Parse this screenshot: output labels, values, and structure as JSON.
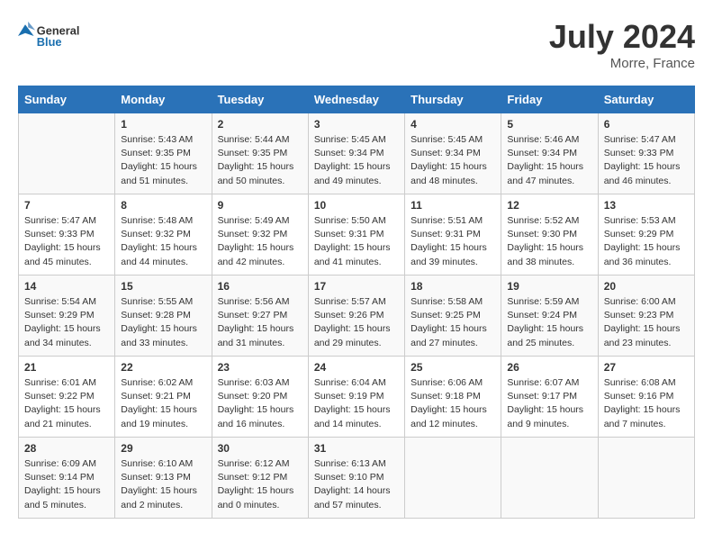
{
  "header": {
    "logo_general": "General",
    "logo_blue": "Blue",
    "month_year": "July 2024",
    "location": "Morre, France"
  },
  "days_of_week": [
    "Sunday",
    "Monday",
    "Tuesday",
    "Wednesday",
    "Thursday",
    "Friday",
    "Saturday"
  ],
  "weeks": [
    [
      {
        "day": "",
        "info": ""
      },
      {
        "day": "1",
        "info": "Sunrise: 5:43 AM\nSunset: 9:35 PM\nDaylight: 15 hours\nand 51 minutes."
      },
      {
        "day": "2",
        "info": "Sunrise: 5:44 AM\nSunset: 9:35 PM\nDaylight: 15 hours\nand 50 minutes."
      },
      {
        "day": "3",
        "info": "Sunrise: 5:45 AM\nSunset: 9:34 PM\nDaylight: 15 hours\nand 49 minutes."
      },
      {
        "day": "4",
        "info": "Sunrise: 5:45 AM\nSunset: 9:34 PM\nDaylight: 15 hours\nand 48 minutes."
      },
      {
        "day": "5",
        "info": "Sunrise: 5:46 AM\nSunset: 9:34 PM\nDaylight: 15 hours\nand 47 minutes."
      },
      {
        "day": "6",
        "info": "Sunrise: 5:47 AM\nSunset: 9:33 PM\nDaylight: 15 hours\nand 46 minutes."
      }
    ],
    [
      {
        "day": "7",
        "info": "Sunrise: 5:47 AM\nSunset: 9:33 PM\nDaylight: 15 hours\nand 45 minutes."
      },
      {
        "day": "8",
        "info": "Sunrise: 5:48 AM\nSunset: 9:32 PM\nDaylight: 15 hours\nand 44 minutes."
      },
      {
        "day": "9",
        "info": "Sunrise: 5:49 AM\nSunset: 9:32 PM\nDaylight: 15 hours\nand 42 minutes."
      },
      {
        "day": "10",
        "info": "Sunrise: 5:50 AM\nSunset: 9:31 PM\nDaylight: 15 hours\nand 41 minutes."
      },
      {
        "day": "11",
        "info": "Sunrise: 5:51 AM\nSunset: 9:31 PM\nDaylight: 15 hours\nand 39 minutes."
      },
      {
        "day": "12",
        "info": "Sunrise: 5:52 AM\nSunset: 9:30 PM\nDaylight: 15 hours\nand 38 minutes."
      },
      {
        "day": "13",
        "info": "Sunrise: 5:53 AM\nSunset: 9:29 PM\nDaylight: 15 hours\nand 36 minutes."
      }
    ],
    [
      {
        "day": "14",
        "info": "Sunrise: 5:54 AM\nSunset: 9:29 PM\nDaylight: 15 hours\nand 34 minutes."
      },
      {
        "day": "15",
        "info": "Sunrise: 5:55 AM\nSunset: 9:28 PM\nDaylight: 15 hours\nand 33 minutes."
      },
      {
        "day": "16",
        "info": "Sunrise: 5:56 AM\nSunset: 9:27 PM\nDaylight: 15 hours\nand 31 minutes."
      },
      {
        "day": "17",
        "info": "Sunrise: 5:57 AM\nSunset: 9:26 PM\nDaylight: 15 hours\nand 29 minutes."
      },
      {
        "day": "18",
        "info": "Sunrise: 5:58 AM\nSunset: 9:25 PM\nDaylight: 15 hours\nand 27 minutes."
      },
      {
        "day": "19",
        "info": "Sunrise: 5:59 AM\nSunset: 9:24 PM\nDaylight: 15 hours\nand 25 minutes."
      },
      {
        "day": "20",
        "info": "Sunrise: 6:00 AM\nSunset: 9:23 PM\nDaylight: 15 hours\nand 23 minutes."
      }
    ],
    [
      {
        "day": "21",
        "info": "Sunrise: 6:01 AM\nSunset: 9:22 PM\nDaylight: 15 hours\nand 21 minutes."
      },
      {
        "day": "22",
        "info": "Sunrise: 6:02 AM\nSunset: 9:21 PM\nDaylight: 15 hours\nand 19 minutes."
      },
      {
        "day": "23",
        "info": "Sunrise: 6:03 AM\nSunset: 9:20 PM\nDaylight: 15 hours\nand 16 minutes."
      },
      {
        "day": "24",
        "info": "Sunrise: 6:04 AM\nSunset: 9:19 PM\nDaylight: 15 hours\nand 14 minutes."
      },
      {
        "day": "25",
        "info": "Sunrise: 6:06 AM\nSunset: 9:18 PM\nDaylight: 15 hours\nand 12 minutes."
      },
      {
        "day": "26",
        "info": "Sunrise: 6:07 AM\nSunset: 9:17 PM\nDaylight: 15 hours\nand 9 minutes."
      },
      {
        "day": "27",
        "info": "Sunrise: 6:08 AM\nSunset: 9:16 PM\nDaylight: 15 hours\nand 7 minutes."
      }
    ],
    [
      {
        "day": "28",
        "info": "Sunrise: 6:09 AM\nSunset: 9:14 PM\nDaylight: 15 hours\nand 5 minutes."
      },
      {
        "day": "29",
        "info": "Sunrise: 6:10 AM\nSunset: 9:13 PM\nDaylight: 15 hours\nand 2 minutes."
      },
      {
        "day": "30",
        "info": "Sunrise: 6:12 AM\nSunset: 9:12 PM\nDaylight: 15 hours\nand 0 minutes."
      },
      {
        "day": "31",
        "info": "Sunrise: 6:13 AM\nSunset: 9:10 PM\nDaylight: 14 hours\nand 57 minutes."
      },
      {
        "day": "",
        "info": ""
      },
      {
        "day": "",
        "info": ""
      },
      {
        "day": "",
        "info": ""
      }
    ]
  ]
}
